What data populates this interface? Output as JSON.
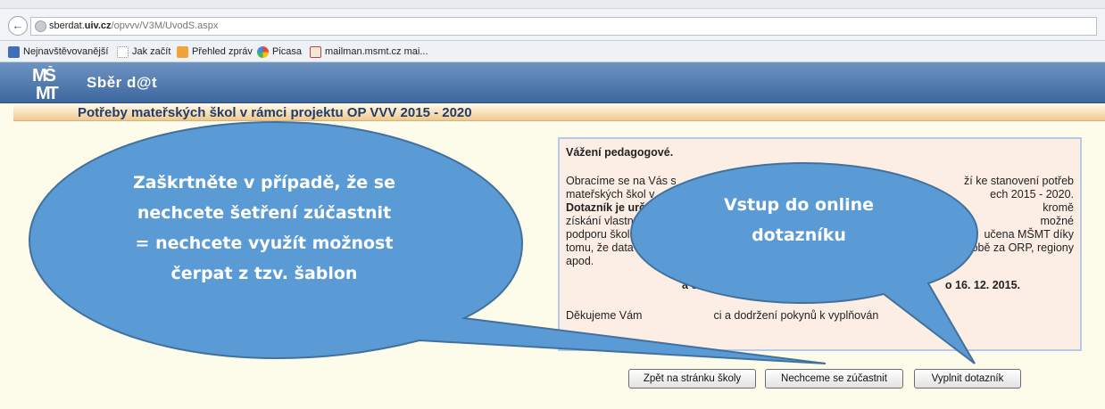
{
  "browser": {
    "url_prefix": "sberdat.",
    "url_domain": "uiv.cz",
    "url_path": "/opvvv/V3M/UvodS.aspx",
    "bookmarks": [
      {
        "label": "Nejnavštěvovanější",
        "color": "#3f6fb8"
      },
      {
        "label": "Jak začít",
        "color": "#dfe3e8"
      },
      {
        "label": "Přehled zpráv",
        "color": "#f0a33a"
      },
      {
        "label": "Picasa",
        "color": "#e04b3a"
      },
      {
        "label": "mailman.msmt.cz mai...",
        "color": "#7b9a3a"
      }
    ]
  },
  "site": {
    "logo_text": "MŠMT",
    "title": "Sběr d@t",
    "page_title": "Potřeby mateřských škol v rámci projektu OP VVV 2015 - 2020"
  },
  "info": {
    "heading": "Vážení pedagogové.",
    "para1_a": "Obracíme se na Vás s",
    "para1_b": "ží ke stanovení potřeb",
    "para1_c": "mateřských škol v",
    "para1_d": "ech 2015 - 2020.",
    "para1_e": "Dotazník je urč",
    "para1_f": "kromě",
    "para1_g": "získání vlastních",
    "para1_h": "možné",
    "para1_i": "podporu škole sme",
    "para1_j": "učena MŠMT díky",
    "para1_k": "tomu, že data budou zpra",
    "para1_l": "podobě za ORP, regiony",
    "para1_m": "apod.",
    "dates": "a odeslání bude možné v době od 7. 12.",
    "dates_end": "o 16. 12. 2015.",
    "thanks": "Děkujeme Vám",
    "thanks_b": "ci a dodržení pokynů k vyplňován"
  },
  "buttons": {
    "back": "Zpět na stránku školy",
    "decline": "Nechceme se zúčastnit",
    "fill": "Vyplnit dotazník"
  },
  "callouts": {
    "left": [
      "Zaškrtněte v případě, že se",
      "nechcete šetření zúčastnit",
      "= nechcete využít možnost",
      "čerpat z tzv. šablon"
    ],
    "right": [
      "Vstup do online",
      "dotazníku"
    ],
    "color": "#5b9bd5"
  }
}
